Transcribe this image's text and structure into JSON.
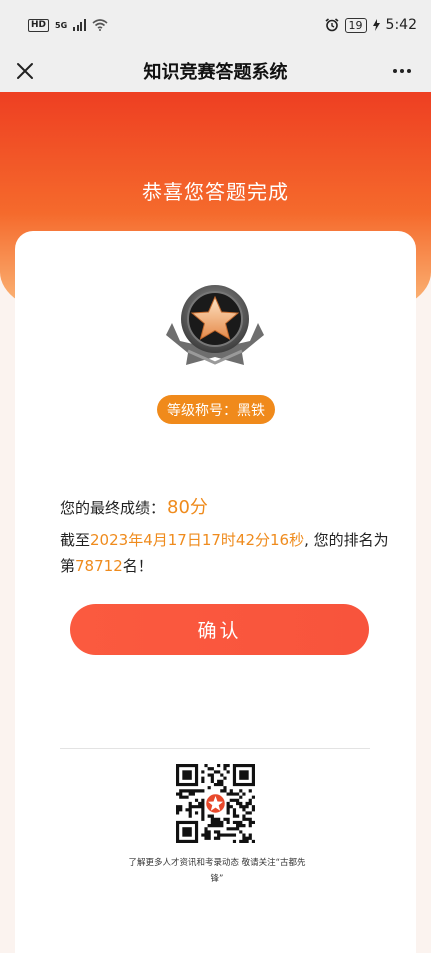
{
  "status_bar": {
    "network_badge": "HD",
    "network_type": "5G",
    "battery_level": "19",
    "time": "5:42"
  },
  "nav": {
    "title": "知识竞赛答题系统"
  },
  "hero": {
    "title": "恭喜您答题完成"
  },
  "result": {
    "rank_title_label": "等级称号：黑铁",
    "score_label": "您的最终成绩：",
    "score_value": "80分",
    "deadline_prefix": "截至",
    "deadline_value": "2023年4月17日17时42分16秒",
    "ranking_middle": ", 您的排名为",
    "rank_prefix": "第",
    "rank_value": "78712",
    "rank_suffix": "名！"
  },
  "actions": {
    "confirm_label": "确认"
  },
  "footer": {
    "note": "了解更多人才资讯和考录动态 敬请关注“古都先锋”"
  },
  "colors": {
    "accent_orange": "#ef8b1d",
    "button_red": "#f8543c",
    "header_red": "#ee3f22"
  }
}
